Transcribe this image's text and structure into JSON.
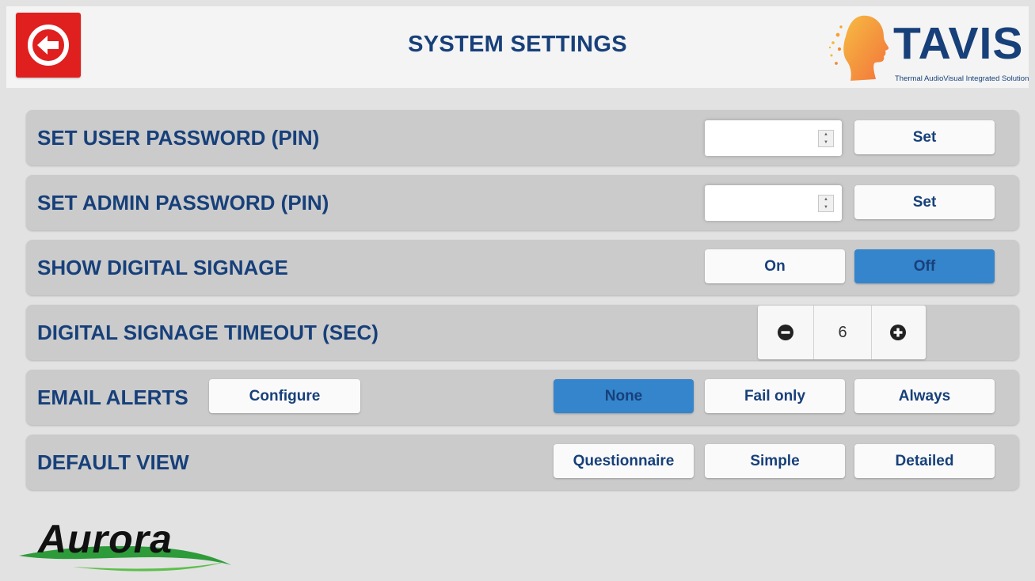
{
  "header": {
    "title": "SYSTEM SETTINGS",
    "back_icon": "back-arrow-icon",
    "back_color": "#e01f1f"
  },
  "brand": {
    "tavis_name": "TAVIS",
    "tavis_tagline": "Thermal AudioVisual Integrated Solution",
    "aurora_name": "Aurora"
  },
  "colors": {
    "title_text": "#17407a",
    "active_button": "#3585cc",
    "row_background": "#cbcbcb"
  },
  "rows": {
    "user_password": {
      "label": "SET USER PASSWORD (PIN)",
      "value": "",
      "set_label": "Set"
    },
    "admin_password": {
      "label": "SET ADMIN PASSWORD (PIN)",
      "value": "",
      "set_label": "Set"
    },
    "digital_signage": {
      "label": "SHOW DIGITAL SIGNAGE",
      "on_label": "On",
      "off_label": "Off",
      "selected": "Off"
    },
    "signage_timeout": {
      "label": "DIGITAL SIGNAGE TIMEOUT (SEC)",
      "value": "6",
      "decrement_icon": "minus-circle-icon",
      "increment_icon": "plus-circle-icon"
    },
    "email_alerts": {
      "label": "EMAIL ALERTS",
      "configure_label": "Configure",
      "options": [
        "None",
        "Fail only",
        "Always"
      ],
      "selected": "None"
    },
    "default_view": {
      "label": "DEFAULT VIEW",
      "options": [
        "Questionnaire",
        "Simple",
        "Detailed"
      ],
      "selected": ""
    }
  }
}
